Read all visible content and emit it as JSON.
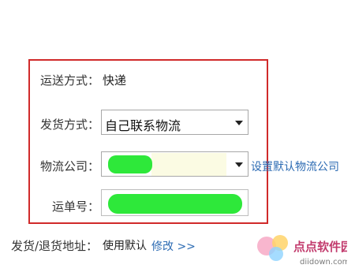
{
  "shipping": {
    "method_label": "运送方式：",
    "method_value": "快递",
    "delivery_label": "发货方式：",
    "delivery_value": "自己联系物流",
    "company_label": "物流公司：",
    "set_default_link": "设置默认物流公司",
    "waybill_label": "运单号："
  },
  "address": {
    "label": "发货/退货地址：",
    "value": "使用默认",
    "edit_link": "修改 >>"
  },
  "watermark": {
    "brand": "点点软件园",
    "site": "diidown.com"
  },
  "colors": {
    "highlight_border": "#d02a2a",
    "link": "#2c6bb3",
    "redaction": "#2ee83a"
  }
}
